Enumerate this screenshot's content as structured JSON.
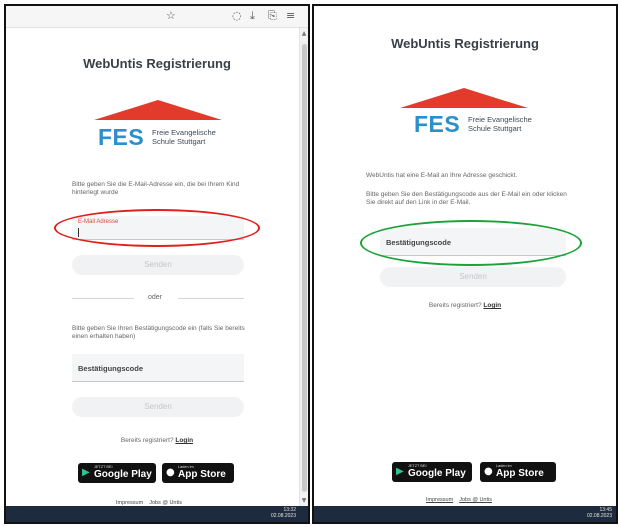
{
  "browser": {
    "icons": [
      "star-icon",
      "pocket-icon",
      "download-icon",
      "extensions-icon",
      "menu-icon"
    ]
  },
  "left": {
    "title": "WebUntis Registrierung",
    "logo": {
      "abbr": "FES",
      "line1": "Freie Evangelische",
      "line2": "Schule Stuttgart"
    },
    "email_prompt": "Bitte geben Sie die E-Mail-Adresse ein, die bei Ihrem Kind hinterlegt wurde",
    "email_label": "E-Mail Adresse",
    "send_label_1": "Senden",
    "divider": "oder",
    "code_prompt": "Bitte geben Sie Ihren Bestätigungscode ein (falls Sie bereits einen erhalten haben)",
    "code_label": "Bestätigungscode",
    "send_label_2": "Senden",
    "registered_text": "Bereits registriert?",
    "login_link": "Login",
    "google_pre": "JETZT BEI",
    "google_name": "Google Play",
    "apple_pre": "Laden im",
    "apple_name": "App Store",
    "footer_impressum": "Impressum",
    "footer_jobs": "Jobs @ Untis",
    "clock_time": "13:32",
    "clock_date": "02.08.2023"
  },
  "right": {
    "title": "WebUntis Registrierung",
    "logo": {
      "abbr": "FES",
      "line1": "Freie Evangelische",
      "line2": "Schule Stuttgart"
    },
    "sent_text": "WebUntis hat eine E-Mail an Ihre Adresse geschickt.",
    "code_prompt": "Bitte geben Sie den Bestätigungscode aus der E-Mail ein oder klicken Sie direkt auf den Link in der E-Mail.",
    "code_label": "Bestätigungscode",
    "send_label": "Senden",
    "registered_text": "Bereits registriert?",
    "login_link": "Login",
    "google_pre": "JETZT BEI",
    "google_name": "Google Play",
    "apple_pre": "Laden im",
    "apple_name": "App Store",
    "footer_impressum": "Impressum",
    "footer_jobs": "Jobs @ Untis",
    "clock_time": "13:45",
    "clock_date": "02.08.2023"
  },
  "colors": {
    "logo_red": "#e23a2b",
    "logo_blue": "#2b8fcb",
    "annotation_red": "#e0201a",
    "annotation_green": "#1aa33a",
    "taskbar": "#1e2a3e"
  }
}
